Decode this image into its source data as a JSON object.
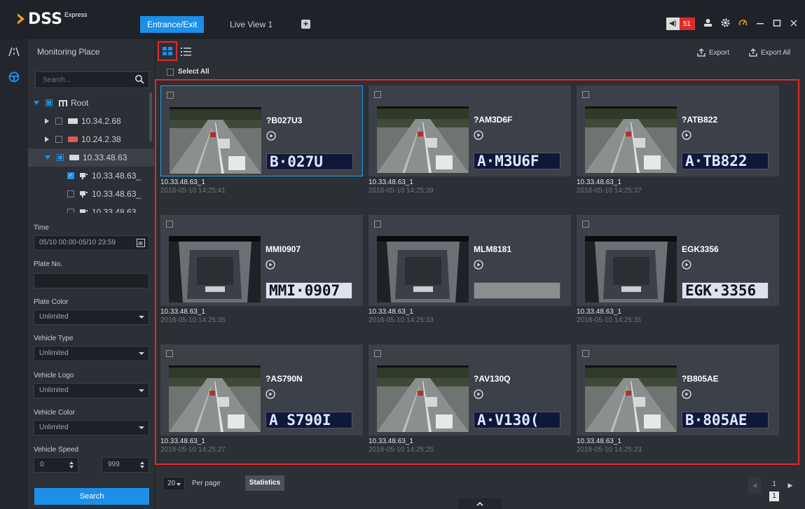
{
  "app": {
    "logo_text": "DSS",
    "logo_sup": "Express",
    "tabs": [
      {
        "label": "Entrance/Exit",
        "active": true
      },
      {
        "label": "Live View 1",
        "active": false
      }
    ],
    "alarm_count": "51",
    "accent_color": "#1c8fe8",
    "alert_color": "#e02a2a"
  },
  "panel": {
    "title": "Monitoring Place",
    "search_placeholder": "Search...",
    "tree": [
      {
        "label": "Root"
      },
      {
        "label": "10.34.2.68"
      },
      {
        "label": "10.24.2.38"
      },
      {
        "label": "10.33.48.63"
      },
      {
        "label": "10.33.48.63_"
      },
      {
        "label": "10.33.48.63_"
      },
      {
        "label": "10.33.48.63"
      }
    ]
  },
  "filters": {
    "time_label": "Time",
    "time_value": "05/10 00:00-05/10 23:59",
    "plate_no_label": "Plate No.",
    "plate_no_value": "",
    "plate_color_label": "Plate Color",
    "plate_color_value": "Unlimited",
    "vehicle_type_label": "Vehicle Type",
    "vehicle_type_value": "Unlimited",
    "vehicle_logo_label": "Vehicle Logo",
    "vehicle_logo_value": "Unlimited",
    "vehicle_color_label": "Vehicle Color",
    "vehicle_color_value": "Unlimited",
    "vehicle_speed_label": "Vehicle Speed",
    "speed_min": "0",
    "speed_max": "999",
    "search_label": "Search"
  },
  "toolbar": {
    "export_label": "Export",
    "export_all_label": "Export All",
    "select_all_label": "Select All"
  },
  "records": [
    {
      "plate": "?B027U3",
      "plate_img": "B·027U",
      "plate_img_prefix": "",
      "scene": "road",
      "channel": "10.33.48.63_1",
      "time": "2018-05-10 14:25:41",
      "selected": true
    },
    {
      "plate": "?AM3D6F",
      "plate_img": "A·M3U6F",
      "plate_img_prefix": "",
      "scene": "road",
      "channel": "10.33.48.63_1",
      "time": "2018-05-10 14:25:39",
      "selected": false
    },
    {
      "plate": "?ATB822",
      "plate_img": "A·TB822",
      "plate_img_prefix": "",
      "scene": "road",
      "channel": "10.33.48.63_1",
      "time": "2018-05-10 14:25:37",
      "selected": false
    },
    {
      "plate": "MMI0907",
      "plate_img": "MMI·0907",
      "plate_img_prefix": "",
      "scene": "tunnel",
      "channel": "10.33.48.63_1",
      "time": "2018-05-10 14:25:35",
      "selected": false
    },
    {
      "plate": "MLM8181",
      "plate_img": "",
      "plate_img_prefix": "",
      "scene": "tunnel",
      "channel": "10.33.48.63_1",
      "time": "2018-05-10 14:25:33",
      "selected": false
    },
    {
      "plate": "EGK3356",
      "plate_img": "EGK·3356",
      "plate_img_prefix": "",
      "scene": "tunnel",
      "channel": "10.33.48.63_1",
      "time": "2018-05-10 14:25:31",
      "selected": false
    },
    {
      "plate": "?AS790N",
      "plate_img": "A S790I",
      "plate_img_prefix": "",
      "scene": "road",
      "channel": "10.33.48.63_1",
      "time": "2018-05-10 14:25:27",
      "selected": false
    },
    {
      "plate": "?AV130Q",
      "plate_img": "A·V130(",
      "plate_img_prefix": "",
      "scene": "road",
      "channel": "10.33.48.63_1",
      "time": "2018-05-10 14:25:25",
      "selected": false
    },
    {
      "plate": "?B805AE",
      "plate_img": "B·805AE",
      "plate_img_prefix": "",
      "scene": "road",
      "channel": "10.33.48.63_1",
      "time": "2018-05-10 14:25:23",
      "selected": false
    }
  ],
  "footer": {
    "per_page_value": "20",
    "per_page_label": "Per page",
    "statistics_label": "Statistics",
    "current_page": "1",
    "total_pages": "1"
  }
}
